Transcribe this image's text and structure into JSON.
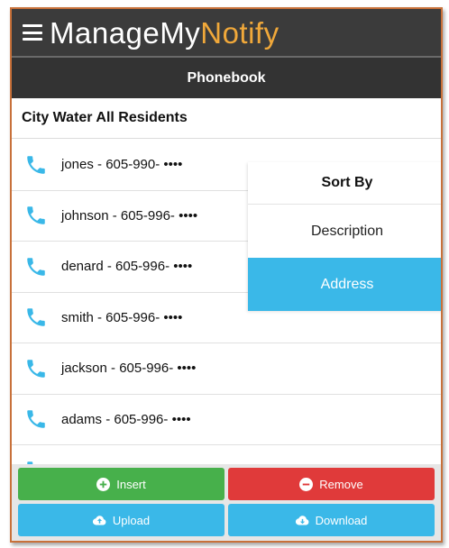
{
  "app": {
    "brand_part1": "ManageMy",
    "brand_part2": "Notify",
    "colors": {
      "accent": "#f0a83a",
      "header": "#3b3b3b",
      "blue": "#3ab8e8",
      "green": "#47b04b",
      "red": "#e03a3a"
    }
  },
  "header": {
    "title": "Phonebook"
  },
  "group": {
    "name": "City Water All Residents"
  },
  "contacts": [
    {
      "label": "jones - 605-990- ••••",
      "icon": "phone-icon"
    },
    {
      "label": "johnson - 605-996- ••••",
      "icon": "phone-icon"
    },
    {
      "label": "denard - 605-996- ••••",
      "icon": "phone-icon"
    },
    {
      "label": "smith - 605-996- ••••",
      "icon": "phone-icon"
    },
    {
      "label": "jackson - 605-996- ••••",
      "icon": "phone-icon"
    },
    {
      "label": "adams - 605-996- ••••",
      "icon": "phone-icon"
    }
  ],
  "sort_menu": {
    "title": "Sort By",
    "options": [
      {
        "label": "Description",
        "selected": false
      },
      {
        "label": "Address",
        "selected": true
      }
    ]
  },
  "actions": {
    "insert": "Insert",
    "remove": "Remove",
    "upload": "Upload",
    "download": "Download"
  }
}
